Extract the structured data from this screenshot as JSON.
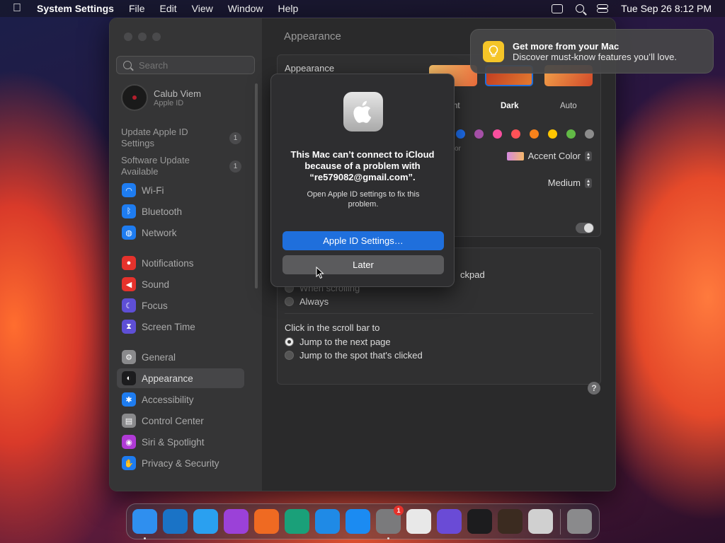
{
  "menubar": {
    "app": "System Settings",
    "menus": [
      "File",
      "Edit",
      "View",
      "Window",
      "Help"
    ],
    "clock": "Tue Sep 26  8:12 PM"
  },
  "sidebar": {
    "search_placeholder": "Search",
    "account": {
      "name": "Calub Viem",
      "sub": "Apple ID"
    },
    "notices": [
      {
        "text": "Update Apple ID Settings",
        "badge": "1"
      },
      {
        "text": "Software Update Available",
        "badge": "1"
      }
    ],
    "items": [
      {
        "label": "Wi-Fi",
        "icon": "wifi-icon",
        "color": "#1e7cf0"
      },
      {
        "label": "Bluetooth",
        "icon": "bluetooth-icon",
        "color": "#1e7cf0"
      },
      {
        "label": "Network",
        "icon": "globe-icon",
        "color": "#1e7cf0"
      },
      {
        "label": "Notifications",
        "icon": "bell-icon",
        "color": "#e5322c"
      },
      {
        "label": "Sound",
        "icon": "speaker-icon",
        "color": "#e5322c"
      },
      {
        "label": "Focus",
        "icon": "moon-icon",
        "color": "#5e4fd6"
      },
      {
        "label": "Screen Time",
        "icon": "hourglass-icon",
        "color": "#5e4fd6"
      },
      {
        "label": "General",
        "icon": "gear-icon",
        "color": "#8a8a8c"
      },
      {
        "label": "Appearance",
        "icon": "appearance-icon",
        "color": "#1c1c1e"
      },
      {
        "label": "Accessibility",
        "icon": "accessibility-icon",
        "color": "#1e7cf0"
      },
      {
        "label": "Control Center",
        "icon": "control-center-icon",
        "color": "#8a8a8c"
      },
      {
        "label": "Siri & Spotlight",
        "icon": "siri-icon",
        "color": "#b03ad6"
      },
      {
        "label": "Privacy & Security",
        "icon": "hand-icon",
        "color": "#1e7cf0"
      }
    ],
    "selected": "Appearance"
  },
  "content": {
    "title": "Appearance",
    "appearance_label": "Appearance",
    "themes": [
      "nt",
      "Dark",
      "Auto"
    ],
    "selected_theme": "Dark",
    "accent_colors": [
      "#1e6ff0",
      "#a550a7",
      "#f74f9e",
      "#ff5257",
      "#f7821b",
      "#ffc600",
      "#62ba46",
      "#8c8c8c"
    ],
    "accent_fragment": "or",
    "highlight_label": "Accent Color",
    "sidebar_size": "Medium",
    "scroll_fragment": "ckpad",
    "scroll_when_fragment": "When scrolling",
    "scroll_always": "Always",
    "click_heading": "Click in the scroll bar to",
    "click_options": [
      "Jump to the next page",
      "Jump to the spot that's clicked"
    ],
    "help": "?"
  },
  "dialog": {
    "title": "This Mac can’t connect to iCloud because of a problem with “re579082@gmail.com”.",
    "body": "Open Apple ID settings to fix this problem.",
    "primary": "Apple ID Settings…",
    "secondary": "Later"
  },
  "notification": {
    "title": "Get more from your Mac",
    "body": "Discover must-know features you’ll love."
  },
  "dock": {
    "badge_count": "1",
    "items": [
      {
        "name": "finder-icon",
        "color": "#2f8fef"
      },
      {
        "name": "vscode-icon",
        "color": "#1a73c6"
      },
      {
        "name": "safari-icon",
        "color": "#2aa0f0"
      },
      {
        "name": "podcasts-icon",
        "color": "#9b41d8"
      },
      {
        "name": "firefox-icon",
        "color": "#ef6a22"
      },
      {
        "name": "sourcetree-icon",
        "color": "#1aa079"
      },
      {
        "name": "keynote-icon",
        "color": "#1f8ae6"
      },
      {
        "name": "appstore-icon",
        "color": "#1b8bf2"
      },
      {
        "name": "system-settings-icon",
        "color": "#7a7a7c"
      },
      {
        "name": "textedit-icon",
        "color": "#e8e8e8"
      },
      {
        "name": "simulator-icon",
        "color": "#6a4bd6"
      },
      {
        "name": "terminal-icon",
        "color": "#1c1c1e"
      },
      {
        "name": "instruments-icon",
        "color": "#3b2b20"
      },
      {
        "name": "launchpad-icon",
        "color": "#d0d0d0"
      },
      {
        "name": "trash-icon",
        "color": "#8a8a8c"
      }
    ]
  }
}
